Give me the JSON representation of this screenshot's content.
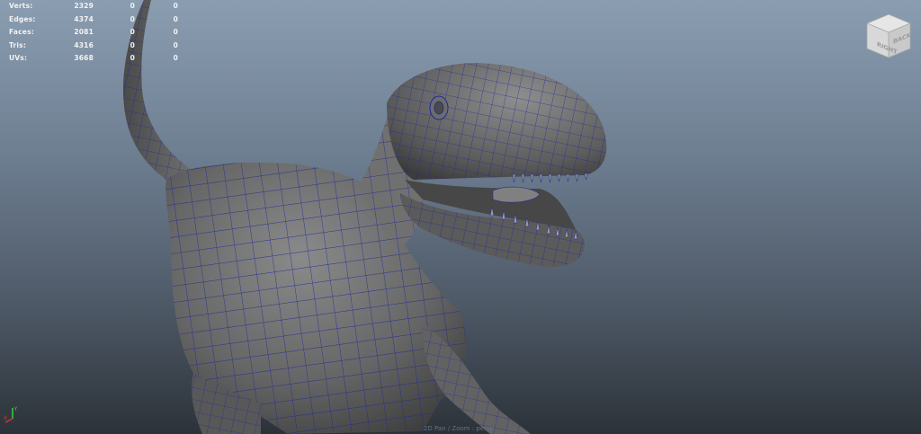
{
  "hud": {
    "rows": [
      {
        "label": "Verts:",
        "v1": "2329",
        "v2": "0",
        "v3": "0"
      },
      {
        "label": "Edges:",
        "v1": "4374",
        "v2": "0",
        "v3": "0"
      },
      {
        "label": "Faces:",
        "v1": "2081",
        "v2": "0",
        "v3": "0"
      },
      {
        "label": "Tris:",
        "v1": "4316",
        "v2": "0",
        "v3": "0"
      },
      {
        "label": "UVs:",
        "v1": "3668",
        "v2": "0",
        "v3": "0"
      }
    ]
  },
  "viewcube": {
    "face_right": "RIGHT",
    "face_back": "BACK"
  },
  "axis": {
    "y_label": "Y",
    "x_label": "X"
  },
  "camera_label": "2D Pan / Zoom : persp",
  "colors": {
    "wireframe": "#1f2a96",
    "mesh": "#6a6a6a",
    "hud_text": "#f2f2f2"
  }
}
